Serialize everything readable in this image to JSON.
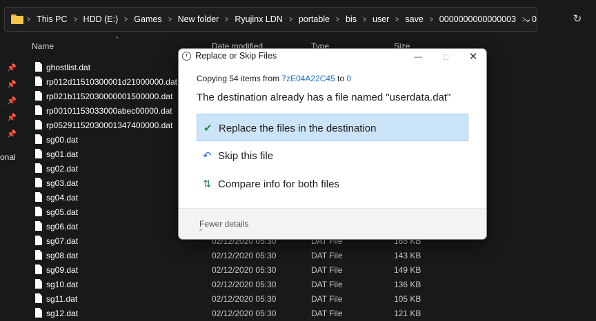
{
  "address_bar": {
    "crumbs": [
      "This PC",
      "HDD (E:)",
      "Games",
      "New folder",
      "Ryujinx LDN",
      "portable",
      "bis",
      "user",
      "save",
      "0000000000000003",
      "0"
    ]
  },
  "columns": {
    "name": "Name",
    "date": "Date modified",
    "type": "Type",
    "size": "Size"
  },
  "sidebar": {
    "partial_label": "onal"
  },
  "files": [
    {
      "name": "ghostlist.dat",
      "date": "",
      "type": "",
      "size": ""
    },
    {
      "name": "rp012d11510300001d21000000.dat",
      "date": "",
      "type": "",
      "size": ""
    },
    {
      "name": "rp021b1152030000001500000.dat",
      "date": "",
      "type": "",
      "size": ""
    },
    {
      "name": "rp00101153033000abec00000.dat",
      "date": "",
      "type": "",
      "size": ""
    },
    {
      "name": "rp05291152030001347400000.dat",
      "date": "",
      "type": "",
      "size": ""
    },
    {
      "name": "sg00.dat",
      "date": "",
      "type": "",
      "size": ""
    },
    {
      "name": "sg01.dat",
      "date": "",
      "type": "",
      "size": ""
    },
    {
      "name": "sg02.dat",
      "date": "",
      "type": "",
      "size": ""
    },
    {
      "name": "sg03.dat",
      "date": "",
      "type": "",
      "size": ""
    },
    {
      "name": "sg04.dat",
      "date": "",
      "type": "",
      "size": ""
    },
    {
      "name": "sg05.dat",
      "date": "",
      "type": "",
      "size": ""
    },
    {
      "name": "sg06.dat",
      "date": "",
      "type": "",
      "size": ""
    },
    {
      "name": "sg07.dat",
      "date": "02/12/2020 05:30",
      "type": "DAT File",
      "size": "165 KB"
    },
    {
      "name": "sg08.dat",
      "date": "02/12/2020 05:30",
      "type": "DAT File",
      "size": "143 KB"
    },
    {
      "name": "sg09.dat",
      "date": "02/12/2020 05:30",
      "type": "DAT File",
      "size": "149 KB"
    },
    {
      "name": "sg10.dat",
      "date": "02/12/2020 05:30",
      "type": "DAT File",
      "size": "136 KB"
    },
    {
      "name": "sg11.dat",
      "date": "02/12/2020 05:30",
      "type": "DAT File",
      "size": "105 KB"
    },
    {
      "name": "sg12.dat",
      "date": "02/12/2020 05:30",
      "type": "DAT File",
      "size": "121 KB"
    }
  ],
  "dialog": {
    "title": "Replace or Skip Files",
    "copying_prefix": "Copying 54 items from",
    "source": "7zE04A22C45",
    "to_word": "to",
    "destination": "0",
    "headline": "The destination already has a file named \"userdata.dat\"",
    "options": [
      {
        "label": "Replace the files in the destination",
        "icon": "check-icon"
      },
      {
        "label": "Skip this file",
        "icon": "undo-icon"
      },
      {
        "label": "Compare info for both files",
        "icon": "compare-icon"
      }
    ],
    "footer_label": "Fewer details"
  },
  "colors": {
    "accent": "#1a6fc9",
    "selection": "#cce4f7",
    "explorer_bg": "#191919",
    "folder": "#f6c545"
  }
}
